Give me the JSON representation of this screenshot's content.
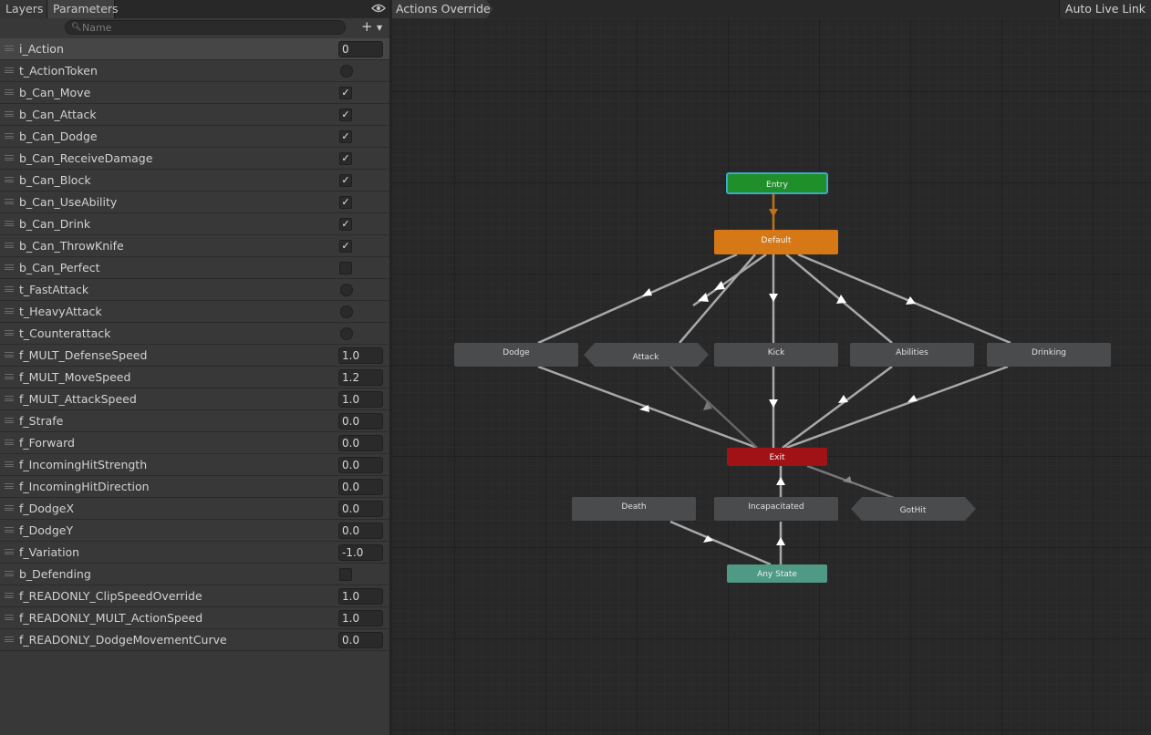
{
  "tabs": {
    "layers": "Layers",
    "parameters": "Parameters"
  },
  "icons": {
    "visibility": "eye-icon",
    "search": "search-icon",
    "add": "plus-icon"
  },
  "search": {
    "placeholder": "Name",
    "value": ""
  },
  "breadcrumb": "Actions Override",
  "auto_live_link": "Auto Live Link",
  "parameters": [
    {
      "name": "i_Action",
      "kind": "value",
      "value": "0"
    },
    {
      "name": "t_ActionToken",
      "kind": "trigger"
    },
    {
      "name": "b_Can_Move",
      "kind": "bool",
      "checked": true
    },
    {
      "name": "b_Can_Attack",
      "kind": "bool",
      "checked": true
    },
    {
      "name": "b_Can_Dodge",
      "kind": "bool",
      "checked": true
    },
    {
      "name": "b_Can_ReceiveDamage",
      "kind": "bool",
      "checked": true
    },
    {
      "name": "b_Can_Block",
      "kind": "bool",
      "checked": true
    },
    {
      "name": "b_Can_UseAbility",
      "kind": "bool",
      "checked": true
    },
    {
      "name": "b_Can_Drink",
      "kind": "bool",
      "checked": true
    },
    {
      "name": "b_Can_ThrowKnife",
      "kind": "bool",
      "checked": true
    },
    {
      "name": "b_Can_Perfect",
      "kind": "bool",
      "checked": false
    },
    {
      "name": "t_FastAttack",
      "kind": "trigger"
    },
    {
      "name": "t_HeavyAttack",
      "kind": "trigger"
    },
    {
      "name": "t_Counterattack",
      "kind": "trigger"
    },
    {
      "name": "f_MULT_DefenseSpeed",
      "kind": "value",
      "value": "1.0"
    },
    {
      "name": "f_MULT_MoveSpeed",
      "kind": "value",
      "value": "1.2"
    },
    {
      "name": "f_MULT_AttackSpeed",
      "kind": "value",
      "value": "1.0"
    },
    {
      "name": "f_Strafe",
      "kind": "value",
      "value": "0.0"
    },
    {
      "name": "f_Forward",
      "kind": "value",
      "value": "0.0"
    },
    {
      "name": "f_IncomingHitStrength",
      "kind": "value",
      "value": "0.0"
    },
    {
      "name": "f_IncomingHitDirection",
      "kind": "value",
      "value": "0.0"
    },
    {
      "name": "f_DodgeX",
      "kind": "value",
      "value": "0.0"
    },
    {
      "name": "f_DodgeY",
      "kind": "value",
      "value": "0.0"
    },
    {
      "name": "f_Variation",
      "kind": "value",
      "value": "-1.0"
    },
    {
      "name": "b_Defending",
      "kind": "bool",
      "checked": false
    },
    {
      "name": "f_READONLY_ClipSpeedOverride",
      "kind": "value",
      "value": "1.0"
    },
    {
      "name": "f_READONLY_MULT_ActionSpeed",
      "kind": "value",
      "value": "1.0"
    },
    {
      "name": "f_READONLY_DodgeMovementCurve",
      "kind": "value",
      "value": "0.0"
    }
  ],
  "states": {
    "entry": "Entry",
    "default": "Default",
    "dodge": "Dodge",
    "attack": "Attack",
    "kick": "Kick",
    "abilities": "Abilities",
    "drinking": "Drinking",
    "exit": "Exit",
    "death": "Death",
    "incapacitated": "Incapacitated",
    "gothit": "GotHit",
    "any_state": "Any State"
  },
  "colors": {
    "entry": "#1f8f2a",
    "default": "#d57815",
    "exit": "#a11216",
    "any_state": "#4e9a85",
    "state": "#4a4b4d",
    "transition": "#a8a8a8"
  }
}
